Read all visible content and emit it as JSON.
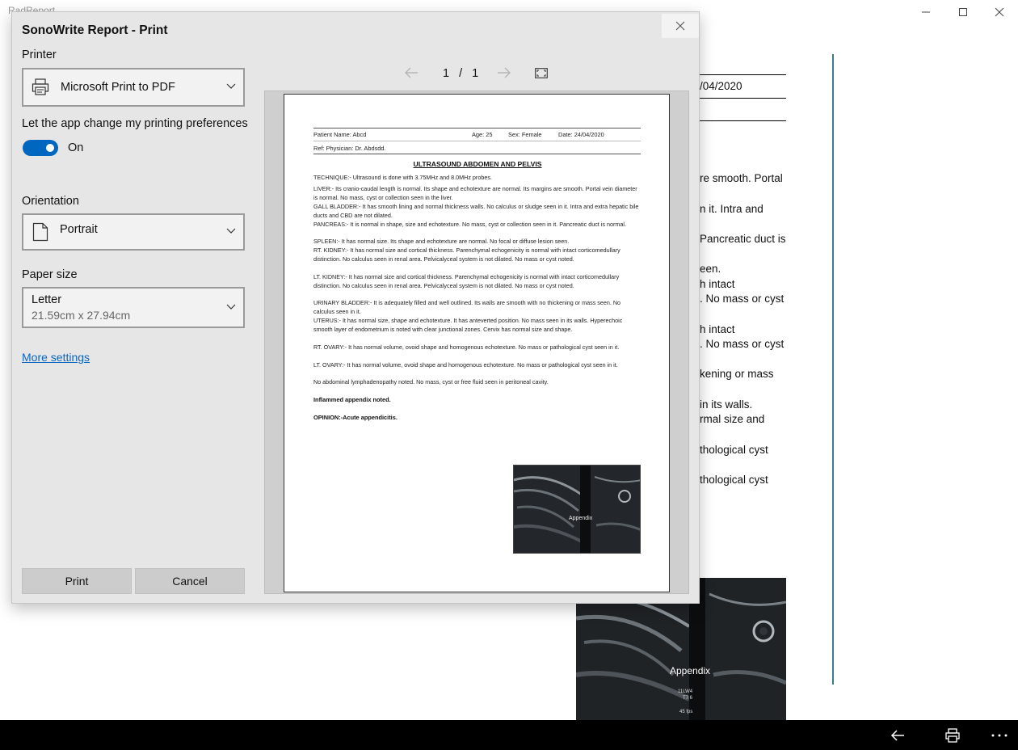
{
  "background_app": {
    "title": "RadReport",
    "window_controls": {
      "minimize": "—",
      "maximize": "☐",
      "close": "✕"
    },
    "visible_fragments": [
      "/04/2020",
      "re smooth. Portal",
      "n it. Intra and",
      "Pancreatic duct is",
      "een.",
      "h intact",
      ". No mass or cyst",
      "h intact",
      ". No mass or cyst",
      "kening or mass",
      "in its walls.",
      "rmal size and",
      "thological cyst",
      "thological cyst"
    ],
    "image_label": "Appendix",
    "image_overlay": [
      "11LW4",
      "T7 6",
      "45 fps"
    ]
  },
  "taskbar": {
    "back_icon": "back-arrow-icon",
    "print_icon": "printer-icon",
    "more_icon": "more-ellipsis-icon"
  },
  "dialog": {
    "title": "SonoWrite Report - Print",
    "printer": {
      "label": "Printer",
      "value": "Microsoft Print to PDF",
      "icon": "printer-icon"
    },
    "preferences": {
      "label": "Let the app change my printing preferences",
      "state": "On",
      "enabled": true
    },
    "orientation": {
      "label": "Orientation",
      "value": "Portrait",
      "icon": "page-icon"
    },
    "paper_size": {
      "label": "Paper size",
      "value": "Letter",
      "sub": "21.59cm x 27.94cm"
    },
    "more_settings": "More settings",
    "buttons": {
      "print": "Print",
      "cancel": "Cancel"
    },
    "pager": {
      "current": "1",
      "separator": "/",
      "total": "1"
    },
    "accent_color": "#0067c0",
    "preview": {
      "patient_name": "Patient Name: Abcd",
      "age": "Age: 25",
      "sex": "Sex: Female",
      "date": "Date: 24/04/2020",
      "ref": "Ref: Physician: Dr. Abdsdd.",
      "heading": "ULTRASOUND ABDOMEN AND PELVIS",
      "paragraphs": [
        "TECHNIQUE:- Ultrasound is done with 3.75MHz and 8.0MHz probes.",
        "LIVER:- Its cranio-caudal length is normal. Its shape and echotexture are normal. Its margins are smooth. Portal vein diameter is normal. No mass, cyst or collection seen in the liver.",
        "GALL BLADDER:- It has smooth lining and normal thickness walls. No calculus or sludge seen in it. Intra and extra hepatic bile ducts and CBD are not dilated.",
        "PANCREAS:- It is normal in shape, size and echotexture. No mass, cyst or collection seen in it. Pancreatic duct is normal.",
        "SPLEEN:- It has normal size. Its shape and echotexture are normal. No focal or diffuse lesion seen.",
        "RT. KIDNEY:- It has normal size and cortical thickness. Parenchymal echogenicity is normal with intact corticomedullary distinction. No calculus seen in renal area. Pelvicalyceal system is not dilated. No mass or cyst noted.",
        "LT. KIDNEY:- It has normal size and cortical thickness. Parenchymal echogenicity is normal with intact corticomedullary distinction. No calculus seen in renal area. Pelvicalyceal system is not dilated. No mass or cyst noted.",
        "URINARY BLADDER:- It is adequately filled and well outlined. Its walls are smooth with no thickening or mass seen. No calculus seen in it.",
        "UTERUS:- It has normal size, shape and echotexture. It has anteverted position. No mass seen in its walls. Hyperechoic smooth layer of endometrium is noted with clear junctional zones. Cervix has normal size and shape.",
        "RT. OVARY:- It has normal volume, ovoid shape and homogenous echotexture. No mass or pathological cyst seen in it.",
        "LT. OVARY:- It has normal volume, ovoid shape and homogenous echotexture. No mass or pathological cyst seen in it.",
        "No abdominal lymphadenopathy noted. No mass, cyst or free fluid seen in peritoneal cavity."
      ],
      "finding": "Inflammed appendix noted.",
      "opinion": "OPINION:-Acute appendicitis.",
      "image_label": "Appendix"
    }
  }
}
